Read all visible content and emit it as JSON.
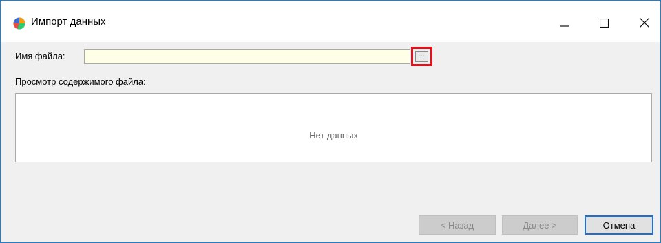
{
  "window": {
    "title": "Импорт данных",
    "controls": {
      "minimize": "minimize-icon",
      "maximize": "maximize-icon",
      "close": "close-icon"
    }
  },
  "form": {
    "file_label": "Имя файла:",
    "file_value": "",
    "browse_label": "...",
    "preview_label": "Просмотр содержимого файла:",
    "preview_empty": "Нет данных"
  },
  "buttons": {
    "back": "< Назад",
    "next": "Далее >",
    "cancel": "Отмена"
  },
  "colors": {
    "highlight": "#e5101c",
    "input_bg": "#ffffe7",
    "accent": "#1d6fd1"
  }
}
